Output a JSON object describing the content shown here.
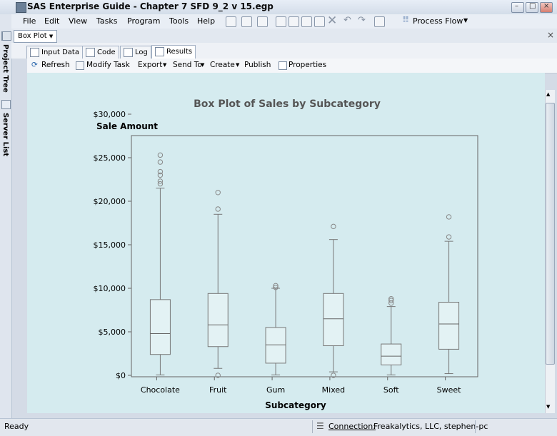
{
  "window": {
    "title": "SAS Enterprise Guide - Chapter 7 SFD 9_2 v 15.egp"
  },
  "menu": [
    "File",
    "Edit",
    "View",
    "Tasks",
    "Program",
    "Tools",
    "Help"
  ],
  "toolbar": {
    "process_flow_label": "Process Flow"
  },
  "sidebar": {
    "project_tree": "Project Tree",
    "server_list": "Server List"
  },
  "doc_tab": {
    "label": "Box Plot"
  },
  "tabs": [
    "Input Data",
    "Code",
    "Log",
    "Results"
  ],
  "results_toolbar": {
    "refresh": "Refresh",
    "modify_task": "Modify Task",
    "export": "Export",
    "send_to": "Send To",
    "create": "Create",
    "publish": "Publish",
    "properties": "Properties"
  },
  "status": {
    "ready": "Ready",
    "connection_label": "Connection:",
    "connection_value": "Freakalytics, LLC, stephen-pc"
  },
  "chart_data": {
    "type": "box",
    "title": "Box Plot of Sales by Subcategory",
    "xlabel": "Subcategory",
    "ylabel": "Sale Amount",
    "ylim": [
      0,
      30000
    ],
    "yticks": [
      "$0",
      "$5,000",
      "$10,000",
      "$15,000",
      "$20,000",
      "$25,000",
      "$30,000"
    ],
    "categories": [
      "Chocolate",
      "Fruit",
      "Gum",
      "Mixed",
      "Soft",
      "Sweet"
    ],
    "boxes": [
      {
        "category": "Chocolate",
        "min": 50,
        "q1": 2400,
        "median": 4800,
        "q3": 8700,
        "max": 21500,
        "outliers": [
          22000,
          22300,
          23000,
          23400,
          24500,
          25300
        ]
      },
      {
        "category": "Fruit",
        "min": 800,
        "q1": 3300,
        "median": 5800,
        "q3": 9400,
        "max": 18500,
        "outliers": [
          19100,
          21000,
          0
        ]
      },
      {
        "category": "Gum",
        "min": 50,
        "q1": 1400,
        "median": 3500,
        "q3": 5500,
        "max": 10000,
        "outliers": [
          10100,
          10300
        ]
      },
      {
        "category": "Mixed",
        "min": 400,
        "q1": 3400,
        "median": 6500,
        "q3": 9400,
        "max": 15600,
        "outliers": [
          17100,
          0
        ]
      },
      {
        "category": "Soft",
        "min": 50,
        "q1": 1200,
        "median": 2200,
        "q3": 3600,
        "max": 7900,
        "outliers": [
          8300,
          8600,
          8800
        ]
      },
      {
        "category": "Sweet",
        "min": 200,
        "q1": 3000,
        "median": 5900,
        "q3": 8400,
        "max": 15400,
        "outliers": [
          15900,
          18200
        ]
      }
    ]
  }
}
